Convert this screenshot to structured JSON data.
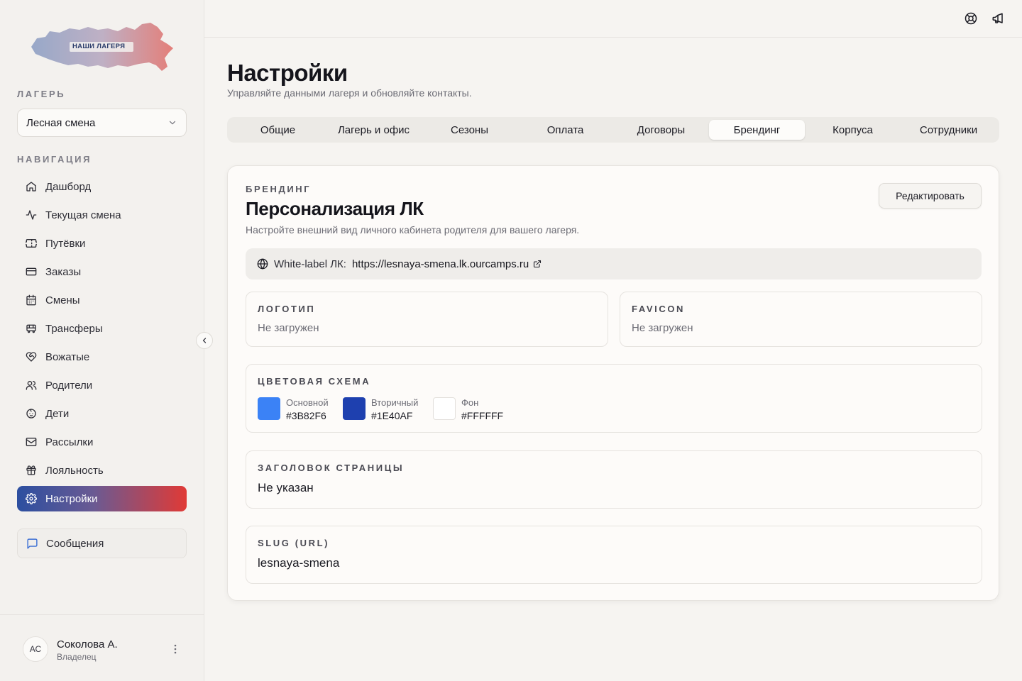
{
  "sidebar": {
    "logo_text": "НАШИ ЛАГЕРЯ",
    "camp_label": "ЛАГЕРЬ",
    "camp_selected": "Лесная смена",
    "nav_label": "НАВИГАЦИЯ",
    "nav_items": [
      {
        "label": "Дашборд",
        "icon": "home-icon"
      },
      {
        "label": "Текущая смена",
        "icon": "activity-icon"
      },
      {
        "label": "Путёвки",
        "icon": "ticket-icon"
      },
      {
        "label": "Заказы",
        "icon": "credit-card-icon"
      },
      {
        "label": "Смены",
        "icon": "calendar-icon"
      },
      {
        "label": "Трансферы",
        "icon": "bus-icon"
      },
      {
        "label": "Вожатые",
        "icon": "heart-handshake-icon"
      },
      {
        "label": "Родители",
        "icon": "users-icon"
      },
      {
        "label": "Дети",
        "icon": "baby-icon"
      },
      {
        "label": "Рассылки",
        "icon": "mail-icon"
      },
      {
        "label": "Лояльность",
        "icon": "gift-icon"
      },
      {
        "label": "Настройки",
        "icon": "gear-icon",
        "active": true
      }
    ],
    "messages_label": "Сообщения",
    "user": {
      "initials": "АС",
      "name": "Соколова А.",
      "role": "Владелец"
    }
  },
  "header": {
    "title": "Настройки",
    "subtitle": "Управляйте данными лагеря и обновляйте контакты."
  },
  "tabs": [
    {
      "label": "Общие"
    },
    {
      "label": "Лагерь и офис"
    },
    {
      "label": "Сезоны"
    },
    {
      "label": "Оплата"
    },
    {
      "label": "Договоры"
    },
    {
      "label": "Брендинг",
      "active": true
    },
    {
      "label": "Корпуса"
    },
    {
      "label": "Сотрудники"
    }
  ],
  "branding": {
    "eyebrow": "БРЕНДИНГ",
    "title": "Персонализация ЛК",
    "description": "Настройте внешний вид личного кабинета родителя для вашего лагеря.",
    "edit_label": "Редактировать",
    "white_label_prefix": "White-label ЛК:",
    "white_label_url": "https://lesnaya-smena.lk.ourcamps.ru",
    "logo": {
      "label": "ЛОГОТИП",
      "value": "Не загружен"
    },
    "favicon": {
      "label": "FAVICON",
      "value": "Не загружен"
    },
    "colors": {
      "label": "ЦВЕТОВАЯ СХЕМА",
      "primary": {
        "name": "Основной",
        "hex": "#3B82F6"
      },
      "secondary": {
        "name": "Вторичный",
        "hex": "#1E40AF"
      },
      "background": {
        "name": "Фон",
        "hex": "#FFFFFF"
      }
    },
    "page_title": {
      "label": "ЗАГОЛОВОК СТРАНИЦЫ",
      "value": "Не указан"
    },
    "slug": {
      "label": "SLUG (URL)",
      "value": "lesnaya-smena"
    }
  },
  "colors": {
    "accent_start": "#2c4fa0",
    "accent_end": "#e03a36"
  }
}
